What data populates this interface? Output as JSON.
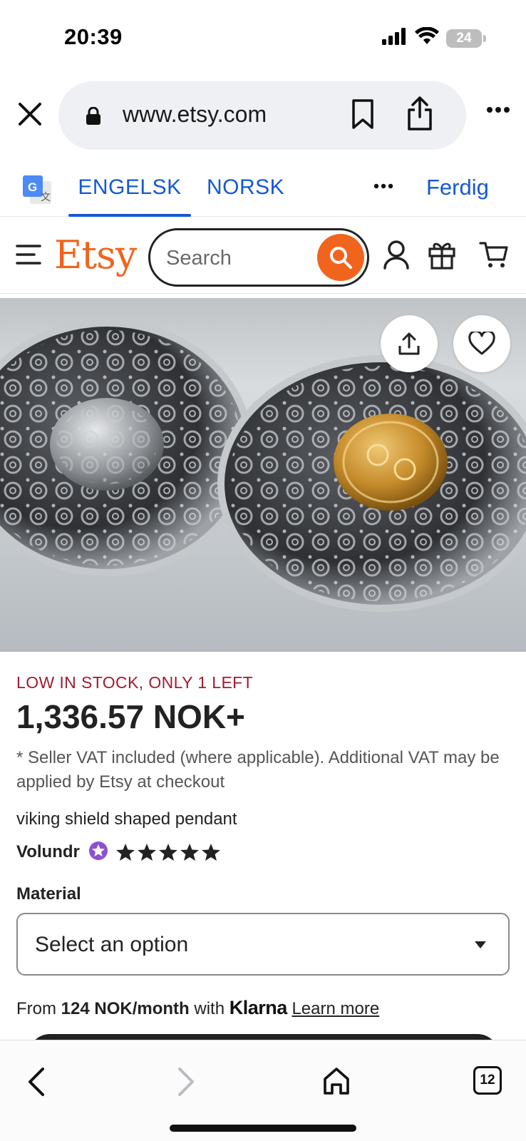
{
  "status_bar": {
    "time": "20:39",
    "battery": "24"
  },
  "browser": {
    "url": "www.etsy.com"
  },
  "translate_bar": {
    "source_tab": "ENGELSK",
    "target_tab": "NORSK",
    "done_label": "Ferdig"
  },
  "etsy_header": {
    "logo": "Etsy",
    "search_placeholder": "Search"
  },
  "product": {
    "stock_status": "LOW IN STOCK, ONLY 1 LEFT",
    "price": "1,336.57 NOK+",
    "vat_note": "* Seller VAT included (where applicable). Additional VAT may be applied by Etsy at checkout",
    "title": "viking shield shaped pendant",
    "seller": "Volundr",
    "rating_stars": 5,
    "material_label": "Material",
    "material_select": "Select an option",
    "klarna": {
      "prefix": "From ",
      "amount": "124 NOK/month",
      "middle": " with ",
      "brand": "Klarna",
      "link": "Learn more"
    }
  },
  "bottom_nav": {
    "tab_count": "12"
  },
  "colors": {
    "etsy_orange": "#f1641e",
    "link_blue": "#1558d6",
    "stock_red": "#a61a2e"
  }
}
